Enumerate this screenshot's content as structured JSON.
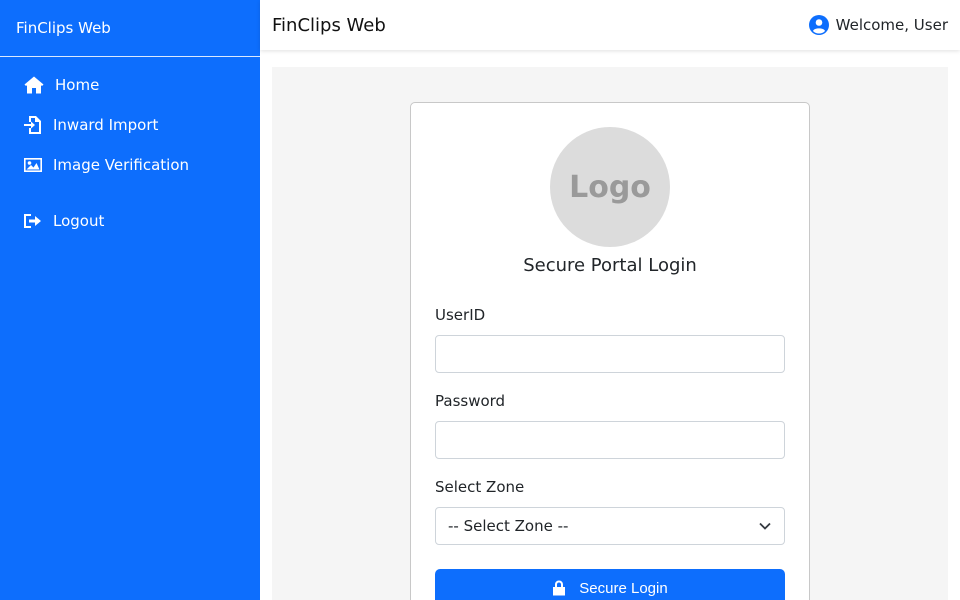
{
  "sidebar": {
    "brand": "FinClips Web",
    "items": [
      {
        "label": "Home",
        "icon": "home-icon"
      },
      {
        "label": "Inward Import",
        "icon": "file-import-icon"
      },
      {
        "label": "Image Verification",
        "icon": "image-icon"
      },
      {
        "label": "Logout",
        "icon": "logout-icon"
      }
    ]
  },
  "header": {
    "title": "FinClips Web",
    "welcome": "Welcome, User",
    "user_icon": "user-circle-icon"
  },
  "login": {
    "logo_text": "Logo",
    "title": "Secure Portal Login",
    "userid_label": "UserID",
    "userid_value": "",
    "password_label": "Password",
    "password_value": "",
    "zone_label": "Select Zone",
    "zone_selected": "-- Select Zone --",
    "submit_label": "Secure Login",
    "submit_icon": "lock-icon"
  },
  "colors": {
    "primary": "#0d6efd",
    "main_bg": "#f5f5f5",
    "logo_bg": "#dcdcdc"
  }
}
